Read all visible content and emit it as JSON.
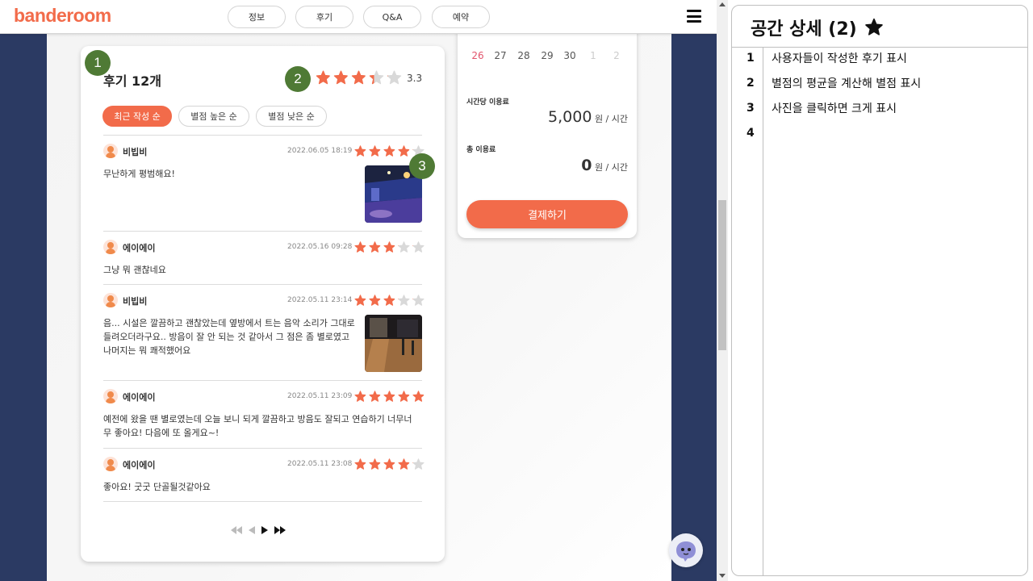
{
  "brand": {
    "name": "banderoom",
    "color": "#f26b4a"
  },
  "nav": {
    "tabs": [
      "정보",
      "후기",
      "Q&A",
      "예약"
    ]
  },
  "reviews": {
    "title": "후기 12개",
    "average": "3.3",
    "average_value": 3.3,
    "sort_buttons": [
      "최근 작성 순",
      "별점 높은 순",
      "별점 낮은 순"
    ],
    "items": [
      {
        "user": "비빕비",
        "date": "2022.06.05 18:19",
        "rating": 4,
        "text": "무난하게 평범해요!",
        "photo": "dark-hall-photo"
      },
      {
        "user": "에이에이",
        "date": "2022.05.16 09:28",
        "rating": 3,
        "text": "그냥 뭐 괜찮네요",
        "photo": null
      },
      {
        "user": "비빕비",
        "date": "2022.05.11 23:14",
        "rating": 3,
        "text": "음... 시설은 깔끔하고 괜찮았는데 옆방에서 트는 음악 소리가 그대로 들려오더라구요.. 방음이 잘 안 되는 것 같아서 그 점은 좀 별로였고 나머지는 뭐 쾌적했어요",
        "photo": "wood-floor-studio-photo"
      },
      {
        "user": "에이에이",
        "date": "2022.05.11 23:09",
        "rating": 5,
        "text": "예전에 왔을 땐 별로였는데 오늘 보니 되게 깔끔하고 방음도 잘되고 연습하기 너무너무 좋아요! 다음에 또 올게요~!",
        "photo": null
      },
      {
        "user": "에이에이",
        "date": "2022.05.11 23:08",
        "rating": 4,
        "text": "좋아요! 굿굿 단골될것같아요",
        "photo": null
      }
    ],
    "pagination": [
      "first-page-icon",
      "prev-page-icon",
      "next-page-icon",
      "last-page-icon"
    ]
  },
  "badges": [
    "1",
    "2",
    "3"
  ],
  "booking": {
    "calendar_days": [
      "26",
      "27",
      "28",
      "29",
      "30",
      "1",
      "2"
    ],
    "hourly_label": "시간당 이용료",
    "hourly_amount": "5,000",
    "hourly_unit": "원 / 시간",
    "total_label": "총 이용료",
    "total_amount": "0",
    "total_unit": "원 / 시간",
    "pay_button": "결제하기"
  },
  "panel": {
    "title": "공간 상세 (2)",
    "notes": [
      {
        "num": "1",
        "text": "사용자들이 작성한 후기 표시"
      },
      {
        "num": "2",
        "text": "별점의 평균을 계산해 별점 표시"
      },
      {
        "num": "3",
        "text": "사진을 클릭하면 크게 표시"
      },
      {
        "num": "4",
        "text": ""
      }
    ]
  },
  "colors": {
    "accent": "#f26b4a",
    "star_empty": "#d9d9d9",
    "badge": "#4f7a35",
    "sidebar_bg": "#2b3a63"
  }
}
